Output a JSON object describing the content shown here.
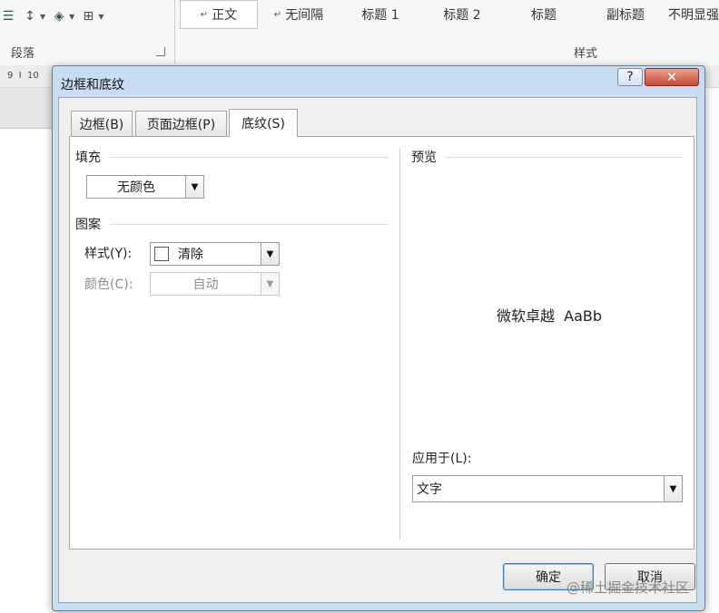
{
  "ribbon": {
    "paragraph_group_label": "段落",
    "styles_group_label": "样式",
    "styles": [
      {
        "label": "正文",
        "mark": "↵",
        "active": true
      },
      {
        "label": "无间隔",
        "mark": "↵",
        "active": false
      },
      {
        "label": "标题 1",
        "mark": "",
        "active": false
      },
      {
        "label": "标题 2",
        "mark": "",
        "active": false
      },
      {
        "label": "标题",
        "mark": "",
        "active": false
      },
      {
        "label": "副标题",
        "mark": "",
        "active": false
      },
      {
        "label": "不明显强",
        "mark": "",
        "active": false
      }
    ],
    "icons": [
      "align-justify-icon",
      "line-spacing-icon",
      "shading-icon",
      "borders-icon"
    ]
  },
  "ruler": {
    "numbers": "9  I  10"
  },
  "dialog": {
    "title": "边框和底纹",
    "help_glyph": "?",
    "close_glyph": "✕",
    "tabs": [
      {
        "label": "边框(B)",
        "active": false
      },
      {
        "label": "页面边框(P)",
        "active": false
      },
      {
        "label": "底纹(S)",
        "active": true
      }
    ],
    "fill": {
      "heading": "填充",
      "value": "无颜色"
    },
    "pattern": {
      "heading": "图案",
      "style_label": "样式(Y):",
      "style_value": "清除",
      "color_label": "颜色(C):",
      "color_value": "自动"
    },
    "preview": {
      "heading": "预览",
      "sample_text": "微软卓越  AaBb"
    },
    "apply_to": {
      "label": "应用于(L):",
      "value": "文字"
    },
    "ok_label": "确定",
    "cancel_label": "取消"
  },
  "watermark": "@稀土掘金技术社区"
}
